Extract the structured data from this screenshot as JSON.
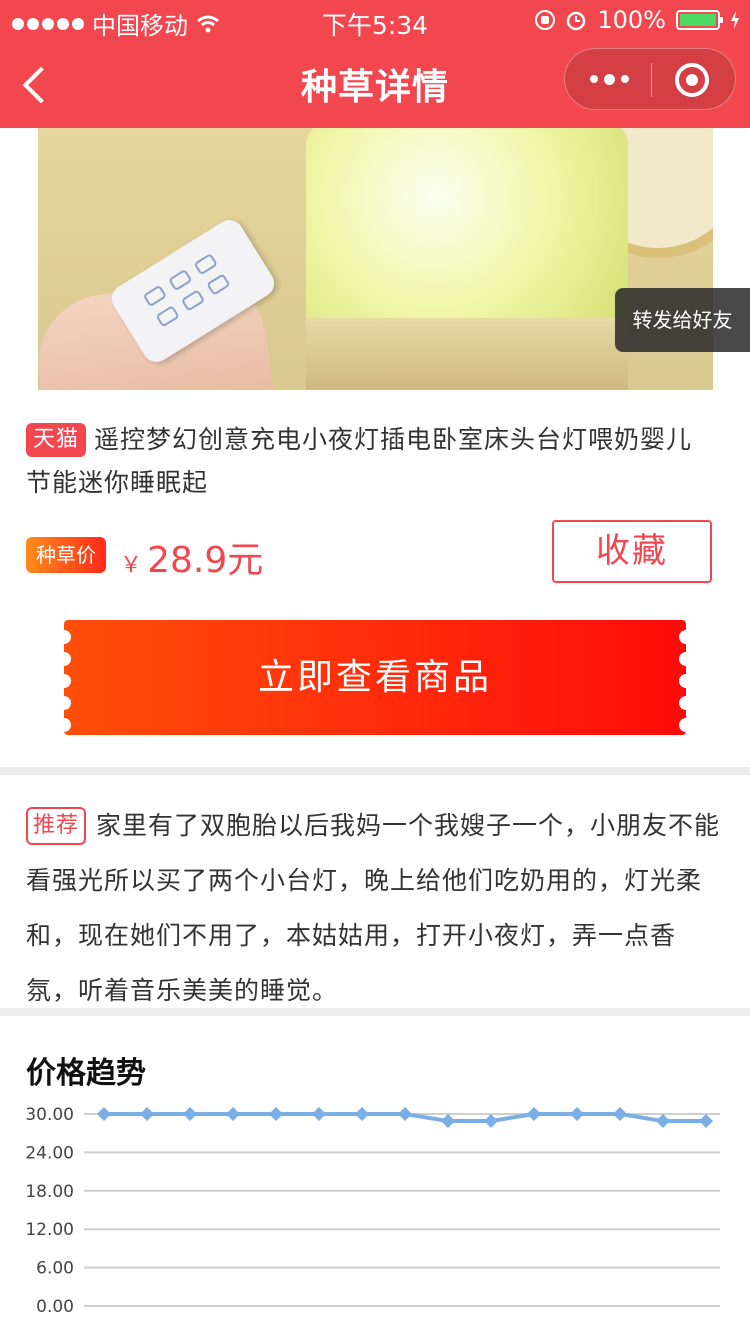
{
  "status_bar": {
    "carrier": "中国移动",
    "time": "下午5:34",
    "battery": "100%"
  },
  "nav": {
    "title": "种草详情"
  },
  "share": {
    "label": "转发给好友"
  },
  "product": {
    "source_tag": "天猫",
    "title": "遥控梦幻创意充电小夜灯插电卧室床头台灯喂奶婴儿节能迷你睡眠起",
    "price_tag": "种草价",
    "currency": "￥",
    "price": "28.9元",
    "favorite_label": "收藏",
    "buy_label": "立即查看商品"
  },
  "recommend": {
    "tag": "推荐",
    "text": "家里有了双胞胎以后我妈一个我嫂子一个，小朋友不能看强光所以买了两个小台灯，晚上给他们吃奶用的，灯光柔和，现在她们不用了，本姑姑用，打开小夜灯，弄一点香氛，听着音乐美美的睡觉。"
  },
  "chart_section": {
    "title": "价格趋势"
  },
  "colors": {
    "brand_red": "#f2474f",
    "line_blue": "#7aaee6"
  },
  "chart_data": {
    "type": "line",
    "title": "价格趋势",
    "y_tick_labels": [
      "30.00",
      "24.00",
      "18.00",
      "12.00",
      "6.00",
      "0.00"
    ],
    "ylim": [
      0,
      30
    ],
    "grid": true,
    "series": [
      {
        "values": [
          30,
          30,
          30,
          30,
          30,
          30,
          30,
          30,
          28.9,
          28.9,
          30,
          30,
          30,
          28.9,
          28.9
        ]
      }
    ]
  }
}
